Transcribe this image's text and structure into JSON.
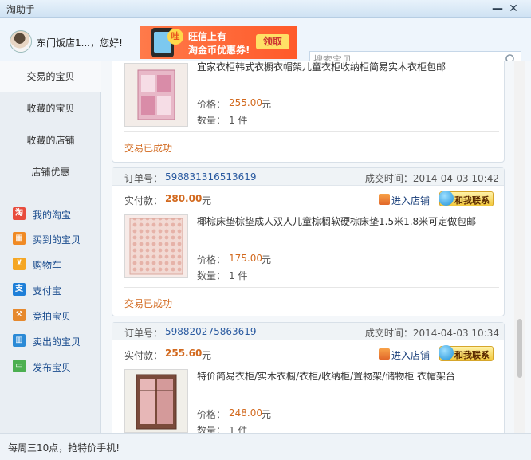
{
  "window": {
    "title": "淘助手"
  },
  "header": {
    "greeting": "东门饭店1...，您好!",
    "banner": {
      "badge": "哇",
      "line1": "旺信上有",
      "line2": "淘金币优惠券!",
      "claim": "领取"
    },
    "search": {
      "placeholder": "搜索宝贝"
    }
  },
  "sidebar": {
    "tabs": [
      {
        "label": "交易的宝贝"
      },
      {
        "label": "收藏的宝贝"
      },
      {
        "label": "收藏的店铺"
      },
      {
        "label": "店铺优惠"
      }
    ],
    "links": [
      {
        "label": "我的淘宝",
        "icon": "taobao-icon",
        "color": "#e84c3d",
        "glyph": "淘"
      },
      {
        "label": "买到的宝贝",
        "icon": "bought-icon",
        "color": "#f08a24",
        "glyph": "▦"
      },
      {
        "label": "购物车",
        "icon": "cart-icon",
        "color": "#f5a623",
        "glyph": "⊻"
      },
      {
        "label": "支付宝",
        "icon": "alipay-icon",
        "color": "#1f7fd8",
        "glyph": "支"
      },
      {
        "label": "竞拍宝贝",
        "icon": "auction-icon",
        "color": "#e6892e",
        "glyph": "⚒"
      },
      {
        "label": "卖出的宝贝",
        "icon": "sold-icon",
        "color": "#2b8ad6",
        "glyph": "▥"
      },
      {
        "label": "发布宝贝",
        "icon": "publish-icon",
        "color": "#4caf50",
        "glyph": "▭"
      }
    ]
  },
  "labels": {
    "order_no": "订单号：",
    "deal_time": "成交时间：",
    "paid": "实付款：",
    "yuan": "元",
    "price": "价格：",
    "qty": "数量：",
    "enter_store": "进入店铺",
    "contact": "和我联系"
  },
  "orders": [
    {
      "item_title": "宜家衣柜韩式衣橱衣帽架儿童衣柜收纳柜简易实木衣柜包邮",
      "price": "255.00",
      "qty": "1 件",
      "status": "交易已成功"
    },
    {
      "order_no": "598831316513619",
      "deal_time": "2014-04-03 10:42",
      "paid": "280.00",
      "item_title": "椰棕床垫棕垫成人双人儿童棕榈软硬棕床垫1.5米1.8米可定做包邮",
      "price": "175.00",
      "qty": "1 件",
      "status": "交易已成功"
    },
    {
      "order_no": "598820275863619",
      "deal_time": "2014-04-03 10:34",
      "paid": "255.60",
      "item_title": "特价简易衣柜/实木衣橱/衣柜/收纳柜/置物架/储物柜 衣帽架台",
      "price": "248.00",
      "qty": "1 件"
    }
  ],
  "footer": {
    "text": "每周三10点，抢特价手机!"
  }
}
